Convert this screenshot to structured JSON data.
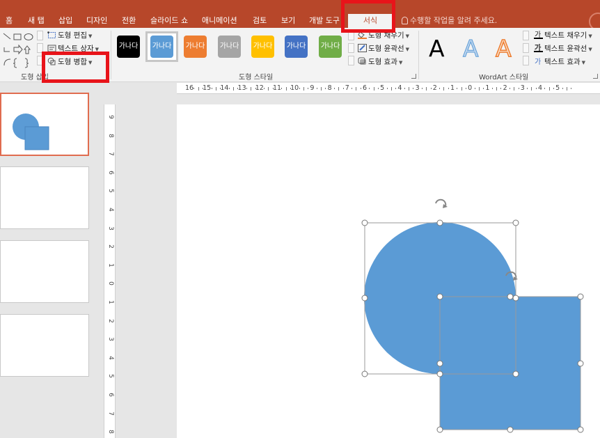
{
  "menu": {
    "tabs": [
      {
        "label": "홈"
      },
      {
        "label": "새 탭"
      },
      {
        "label": "삽입"
      },
      {
        "label": "디자인"
      },
      {
        "label": "전환"
      },
      {
        "label": "슬라이드 쇼"
      },
      {
        "label": "애니메이션"
      },
      {
        "label": "검토"
      },
      {
        "label": "보기"
      },
      {
        "label": "개발 도구"
      },
      {
        "label": "서식",
        "active": true
      }
    ],
    "tell_me": "수행할 작업을 알려 주세요."
  },
  "ribbon": {
    "insert_shapes": {
      "label": "도형 삽입",
      "edit_shape": "도형 편집",
      "text_box": "텍스트 상자",
      "merge_shapes": "도형 병합"
    },
    "shape_styles": {
      "label": "도형 스타일",
      "swatch_text": "가나다",
      "swatches": [
        {
          "color": "#000000"
        },
        {
          "color": "#5b9bd5",
          "selected": true
        },
        {
          "color": "#ed7d31"
        },
        {
          "color": "#a5a5a5"
        },
        {
          "color": "#ffc000"
        },
        {
          "color": "#4472c4"
        },
        {
          "color": "#70ad47"
        }
      ],
      "fill": "도형 채우기",
      "outline": "도형 윤곽선",
      "effects": "도형 효과"
    },
    "wordart": {
      "label": "WordArt 스타일",
      "sample_letter": "A",
      "text_fill": "텍스트 채우기",
      "text_outline": "텍스트 윤곽선",
      "text_effects": "텍스트 효과"
    }
  },
  "ruler": {
    "horizontal_labels": [
      "16",
      "15",
      "14",
      "13",
      "12",
      "11",
      "10",
      "9",
      "8",
      "7",
      "6",
      "5",
      "4",
      "3",
      "2",
      "1",
      "0",
      "1",
      "2",
      "3",
      "4",
      "5"
    ],
    "vertical_labels": [
      "9",
      "8",
      "7",
      "6",
      "5",
      "4",
      "3",
      "2",
      "1",
      "0",
      "1",
      "2",
      "3",
      "4",
      "5",
      "6",
      "7",
      "8"
    ]
  },
  "slides": {
    "thumbnail_count": 4,
    "active_index": 0
  },
  "canvas": {
    "shapes": [
      {
        "kind": "circle",
        "fill": "#5b9bd5",
        "selected": true
      },
      {
        "kind": "square",
        "fill": "#5b9bd5",
        "selected": true
      }
    ]
  },
  "colors": {
    "menu_background": "#b7472a",
    "ribbon_background": "#f3f3f3",
    "shape_fill": "#5b9bd5",
    "highlight": "#e8141a"
  }
}
